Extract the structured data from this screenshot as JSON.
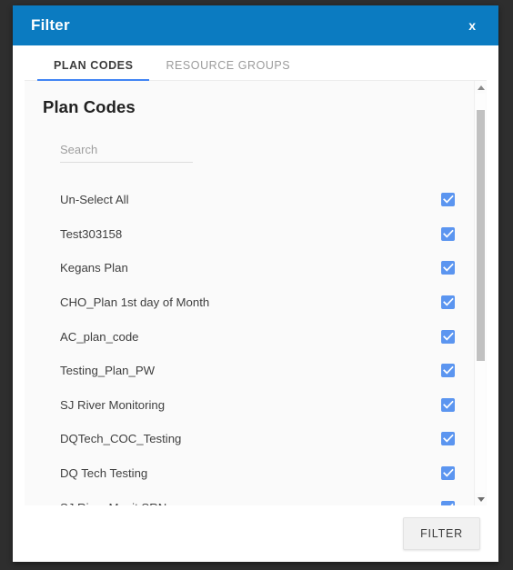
{
  "dialog": {
    "title": "Filter",
    "close_label": "x",
    "accent_color": "#0b7bc1",
    "tab_underline_color": "#4285f4",
    "checkbox_color": "#5b95f0"
  },
  "tabs": [
    {
      "label": "PLAN CODES",
      "active": true
    },
    {
      "label": "RESOURCE GROUPS",
      "active": false
    }
  ],
  "panel": {
    "heading": "Plan Codes",
    "search": {
      "placeholder": "Search",
      "value": ""
    },
    "items": [
      {
        "label": "Un-Select All",
        "checked": true
      },
      {
        "label": "Test303158",
        "checked": true
      },
      {
        "label": "Kegans Plan",
        "checked": true
      },
      {
        "label": "CHO_Plan 1st day of Month",
        "checked": true
      },
      {
        "label": "AC_plan_code",
        "checked": true
      },
      {
        "label": "Testing_Plan_PW",
        "checked": true
      },
      {
        "label": "SJ River Monitoring",
        "checked": true
      },
      {
        "label": "DQTech_COC_Testing",
        "checked": true
      },
      {
        "label": "DQ Tech Testing",
        "checked": true
      },
      {
        "label": "SJ River Monit SRN",
        "checked": true
      }
    ]
  },
  "footer": {
    "filter_label": "FILTER"
  }
}
